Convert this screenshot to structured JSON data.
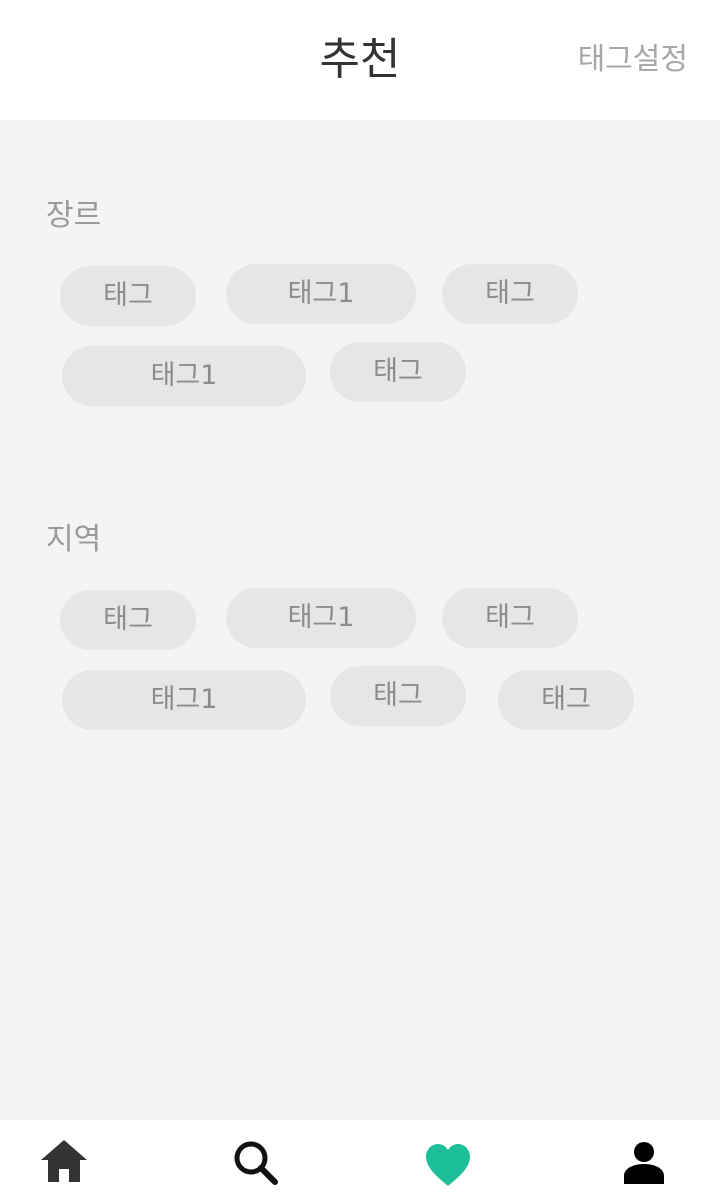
{
  "header": {
    "title": "추천",
    "action_label": "태그설정"
  },
  "sections": [
    {
      "label": "장르",
      "tags": [
        "태그",
        "태그1",
        "태그",
        "태그1",
        "태그"
      ]
    },
    {
      "label": "지역",
      "tags": [
        "태그",
        "태그1",
        "태그",
        "태그1",
        "태그",
        "태그"
      ]
    }
  ],
  "bottom_nav": {
    "items": [
      {
        "icon": "home-icon"
      },
      {
        "icon": "search-icon"
      },
      {
        "icon": "heart-icon",
        "active": true
      },
      {
        "icon": "person-icon"
      }
    ]
  },
  "colors": {
    "accent": "#1dbf98",
    "icon_dark": "#333333",
    "tag_bg": "#e6e6e6",
    "tag_text": "#8c8c8c"
  }
}
